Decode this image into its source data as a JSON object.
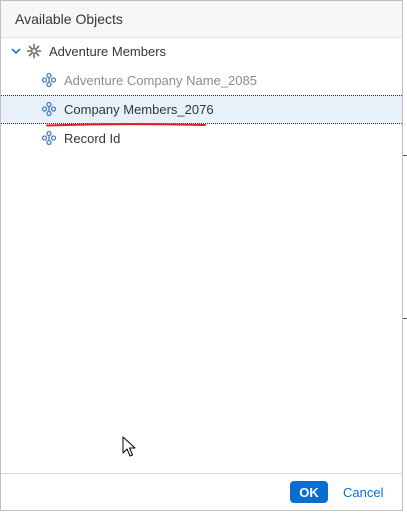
{
  "dialog": {
    "title": "Available Objects",
    "ok_label": "OK",
    "cancel_label": "Cancel"
  },
  "tree": {
    "root": {
      "label": "Adventure Members",
      "expanded": true,
      "icon": "dimension-icon"
    },
    "children": [
      {
        "label": "Adventure Company Name_2085",
        "state": "disabled",
        "icon": "hierarchy-icon"
      },
      {
        "label": "Company Members_2076",
        "state": "selected",
        "icon": "hierarchy-icon"
      },
      {
        "label": "Record Id",
        "state": "normal",
        "icon": "hierarchy-icon"
      }
    ]
  },
  "colors": {
    "accent": "#0a6ed1",
    "selection": "#e8f0f9",
    "annotation": "#e02020"
  }
}
